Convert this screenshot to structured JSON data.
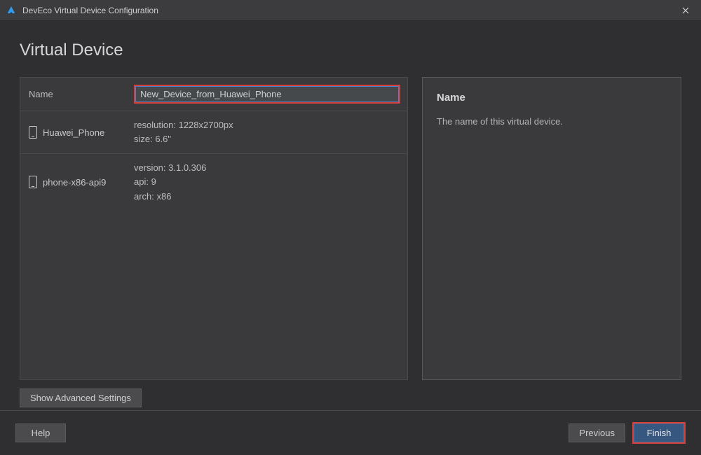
{
  "window": {
    "title": "DevEco Virtual Device Configuration"
  },
  "page": {
    "heading": "Virtual Device"
  },
  "form": {
    "name_label": "Name",
    "name_value": "New_Device_from_Huawei_Phone"
  },
  "devices": [
    {
      "label": "Huawei_Phone",
      "line1": "resolution: 1228x2700px",
      "line2": "size: 6.6\"",
      "line3": ""
    },
    {
      "label": "phone-x86-api9",
      "line1": "version: 3.1.0.306",
      "line2": "api: 9",
      "line3": "arch: x86"
    }
  ],
  "info": {
    "title": "Name",
    "body": "The name of this virtual device."
  },
  "buttons": {
    "advanced": "Show Advanced Settings",
    "help": "Help",
    "previous": "Previous",
    "finish": "Finish"
  },
  "highlight_color": "#d7403a"
}
